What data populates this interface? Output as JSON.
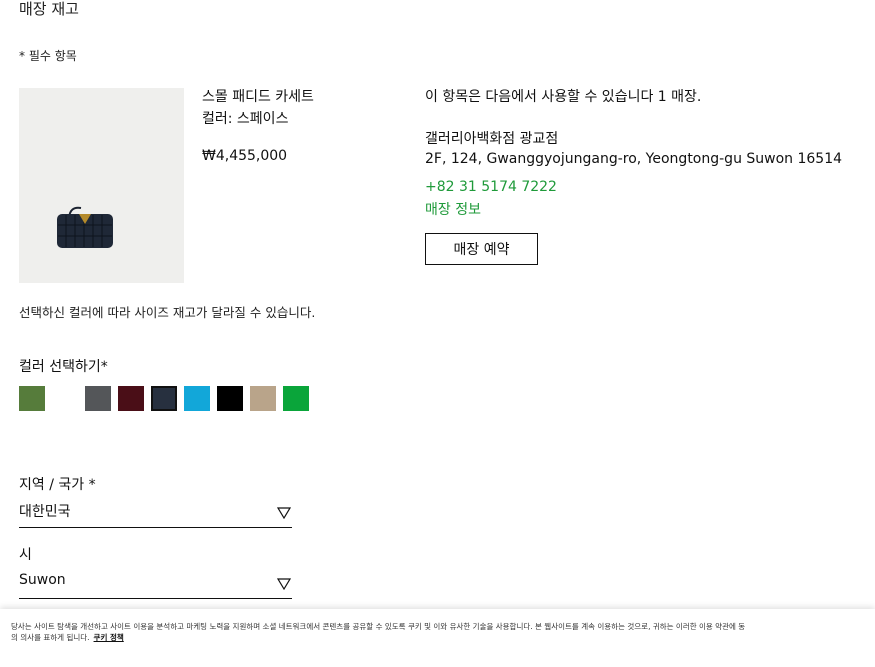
{
  "page": {
    "title": "매장 재고",
    "required_note": "* 필수 항목"
  },
  "product": {
    "name": "스몰 패디드 카세트",
    "color": "컬러: 스페이스",
    "price": "₩4,455,000",
    "image_icon": "bag-icon"
  },
  "availability": {
    "text": "이 항목은 다음에서 사용할 수 있습니다 1 매장.",
    "store_name": "갤러리아백화점 광교점",
    "store_address": "2F, 124, Gwanggyojungang-ro, Yeongtong-gu Suwon 16514",
    "store_phone": "+82 31 5174 7222",
    "store_info_link": "매장 정보",
    "reserve_button": "매장 예약",
    "link_color": "#1f9a3a"
  },
  "colors": {
    "size_note": "선택하신 컬러에 따라 사이즈 재고가 달라질 수 있습니다.",
    "label": "컬러 선택하기*",
    "swatches": [
      "#567c3b",
      "#ffffff",
      "#545659",
      "#4a0e17",
      "#27303f",
      "#12a7d9",
      "#000000",
      "#b9a48a",
      "#0aa53a"
    ],
    "selected_index": 4
  },
  "region": {
    "label": "지역 / 국가 *",
    "value": "대한민국"
  },
  "city": {
    "label": "시",
    "value": "Suwon"
  },
  "cookie": {
    "text": "당사는 사이트 탐색을 개선하고 사이트 이용을 분석하고 마케팅 노력을 지원하며 소셜 네트워크에서 콘텐츠를 공유할 수 있도록 쿠키 및 이와 유사한 기술을 사용합니다. 본 웹사이트를 계속 이용하는 것으로, 귀하는 이러한 이용 약관에 동의 의사를 표하게 됩니다.",
    "link": "쿠키 정책"
  }
}
